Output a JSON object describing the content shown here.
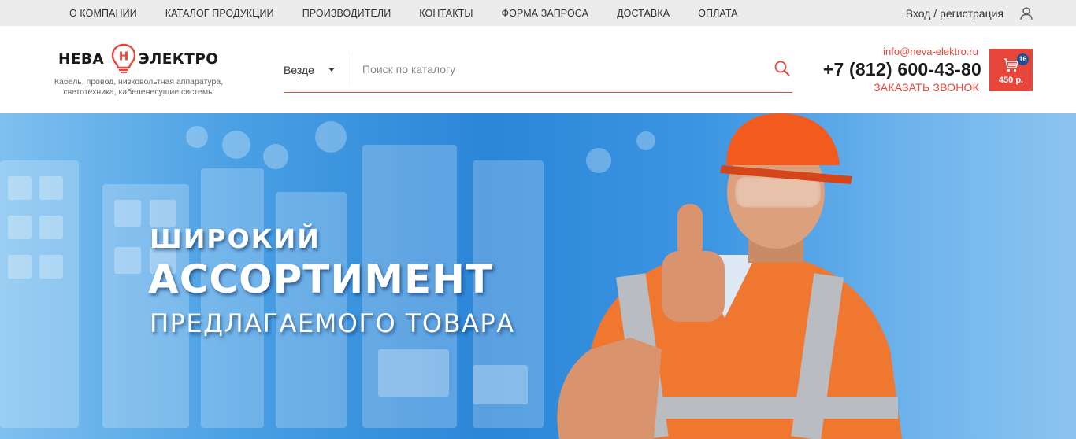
{
  "topnav": {
    "items": [
      "О компании",
      "Каталог продукции",
      "Производители",
      "Контакты",
      "Форма запроса",
      "Доставка",
      "Оплата"
    ],
    "login": "Вход / регистрация"
  },
  "logo": {
    "word1": "НЕВА",
    "letter": "Н",
    "word2": "ЭЛЕКТРО",
    "tagline": "Кабель, провод, низковольтная аппаратура, светотехника, кабеленесущие системы"
  },
  "search": {
    "scope": "Везде",
    "placeholder": "Поиск по каталогу"
  },
  "contacts": {
    "email": "info@neva-elektro.ru",
    "phone": "+7 (812) 600-43-80",
    "callback": "Заказать звонок"
  },
  "cart": {
    "count": "16",
    "total": "450 р."
  },
  "banner": {
    "line1": "ШИРОКИЙ",
    "line2": "АССОРТИМЕНТ",
    "line3": "ПРЕДЛАГАЕМОГО ТОВАРА"
  },
  "colors": {
    "accent": "#e8463a",
    "badge": "#1a4fa0",
    "topbar": "#ececec",
    "banner_blue": "#2c86d8"
  }
}
